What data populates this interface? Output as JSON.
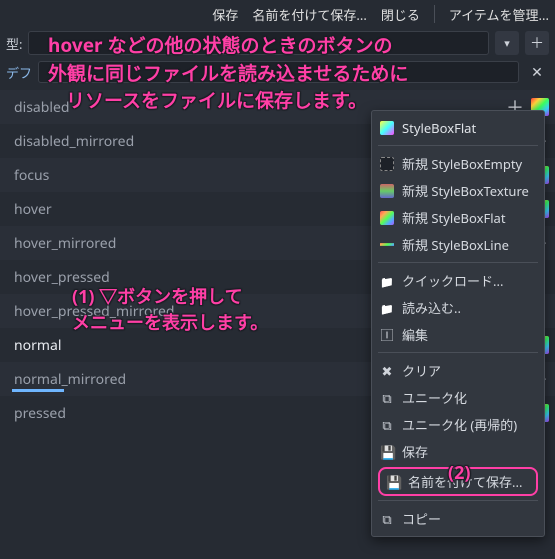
{
  "topbar": {
    "save": "保存",
    "save_as": "名前を付けて保存...",
    "close": "閉じる",
    "manage": "アイテムを管理..."
  },
  "row2": {
    "type_label": "型:"
  },
  "row3": {
    "default_tab": "デフ"
  },
  "props": {
    "items": [
      {
        "label": "disabled",
        "plus": true,
        "swatch": true
      },
      {
        "label": "disabled_mirrored",
        "plus": true,
        "swatch": false
      },
      {
        "label": "focus",
        "plus": true,
        "swatch": true
      },
      {
        "label": "hover",
        "plus": true,
        "swatch": true
      },
      {
        "label": "hover_mirrored",
        "plus": true,
        "swatch": false
      },
      {
        "label": "hover_pressed",
        "plus": false,
        "swatch": false
      },
      {
        "label": "hover_pressed_mirrored",
        "plus": false,
        "swatch": false
      },
      {
        "label": "normal",
        "plus": false,
        "swatch": true,
        "active": true,
        "tools": true
      },
      {
        "label": "normal_mirrored",
        "plus": true,
        "swatch": false
      },
      {
        "label": "pressed",
        "plus": true,
        "swatch": true
      }
    ]
  },
  "flyout": {
    "head": "StyleBoxFlat",
    "new_empty": "新規 StyleBoxEmpty",
    "new_texture": "新規 StyleBoxTexture",
    "new_flat": "新規 StyleBoxFlat",
    "new_line": "新規 StyleBoxLine",
    "quickload": "クイックロード...",
    "load": "読み込む..",
    "edit": "編集",
    "clear": "クリア",
    "unique": "ユニーク化",
    "unique_rec": "ユニーク化 (再帰的)",
    "save": "保存",
    "save_as": "名前を付けて保存...",
    "copy": "コピー"
  },
  "anno": {
    "top1": "hover などの他の状態のときのボタンの",
    "top2": "外観に同じファイルを読み込ませるために",
    "top3": "リソースをファイルに保存します。",
    "mid1": "(1) ▽ボタンを押して",
    "mid2": "メニューを表示します。",
    "num2": "(2)"
  }
}
